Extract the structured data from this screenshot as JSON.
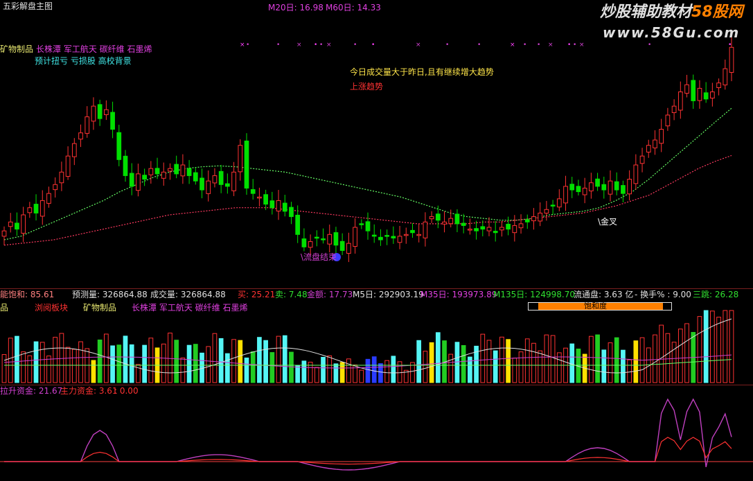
{
  "window": {
    "title": "五彩解盘主图"
  },
  "ma_header": {
    "m20": "M20日: 16.98",
    "m60": "M60日: 14.33"
  },
  "watermark": {
    "line1": "炒股辅助教材",
    "line1b": "58股网",
    "line2": "www.58Gu.com"
  },
  "tags": {
    "sector": "矿物制品",
    "concepts": "长株潭 军工航天 碳纤维 石墨烯",
    "tips": "预计扭亏 亏损股 高校背景"
  },
  "annotations": {
    "volume_note": "今日成交量大于昨日,且有继续增大趋势",
    "trend_note": "上涨趋势",
    "left_label": "\\流盘结束",
    "gold_cross": "\\金叉"
  },
  "volume_header": {
    "saturation": "能饱和: 85.61",
    "forecast": "预测量: 326864.88",
    "volume": "成交量: 326864.88",
    "buy": "买: 25.21",
    "sell": "卖: 7.48",
    "amount": "金额: 17.73",
    "m5": "M5日: 292903.19",
    "m35": "M35日: 193973.89",
    "m135": "M135日: 124998.70",
    "float": "流通盘: 3.63 亿",
    "turnover": "- 换手% : 9.00",
    "sanqu": "三跳: 26.28"
  },
  "volume_tags": {
    "left": "品",
    "hot": "浏阅板块",
    "sector": "矿物制品",
    "concepts": "长株潭 军工航天 碳纤维 石墨烯",
    "bar_label": "饱和度"
  },
  "capital_header": {
    "rise": "拉升资金: 21.67",
    "main": "主力资金: 3.61",
    "zero": ": 0.00"
  },
  "colors": {
    "up": "#ff3232",
    "down": "#00e000",
    "ma_green": "#66ff66",
    "ma_red": "#ff3a60",
    "vol_cyan": "#55f5f5",
    "vol_yellow": "#ffe000",
    "vol_green": "#22cc22",
    "vol_blue": "#2a3cff",
    "magenta": "#d040d0",
    "orange": "#ff8000"
  },
  "chart_data": [
    {
      "type": "candlestick",
      "name": "price",
      "series": [
        {
          "name": "M20日",
          "values": [
            9.6,
            9.8,
            10.2,
            10.6,
            11,
            11.4,
            11.8,
            12.3,
            12.7,
            13.1,
            13.4,
            13.6,
            13.7,
            13.75,
            13.7,
            13.6,
            13.5,
            13.4,
            13.2,
            13,
            12.8,
            12.6,
            12.4,
            12.2,
            12,
            11.7,
            11.4,
            11.1,
            10.9,
            10.8,
            10.7,
            10.7,
            10.8,
            11,
            11.1,
            11.2,
            11.4,
            11.8,
            12.3,
            13,
            13.8,
            14.6,
            15.4,
            16.2,
            16.98
          ]
        },
        {
          "name": "M60日",
          "values": [
            9.3,
            9.4,
            9.5,
            9.6,
            9.8,
            10,
            10.2,
            10.4,
            10.6,
            10.8,
            11,
            11.1,
            11.2,
            11.3,
            11.4,
            11.4,
            11.4,
            11.3,
            11.2,
            11.1,
            11,
            10.9,
            10.8,
            10.7,
            10.6,
            10.5,
            10.5,
            10.5,
            10.5,
            10.6,
            10.6,
            10.7,
            10.8,
            10.9,
            11,
            11.1,
            11.3,
            11.5,
            11.8,
            12.1,
            12.6,
            13.1,
            13.6,
            14,
            14.33
          ]
        }
      ]
    },
    {
      "type": "bar",
      "name": "volume",
      "series": [
        {
          "name": "成交量"
        }
      ]
    },
    {
      "type": "line",
      "name": "capital",
      "series": [
        {
          "name": "拉升资金"
        },
        {
          "name": "主力资金"
        }
      ]
    }
  ]
}
